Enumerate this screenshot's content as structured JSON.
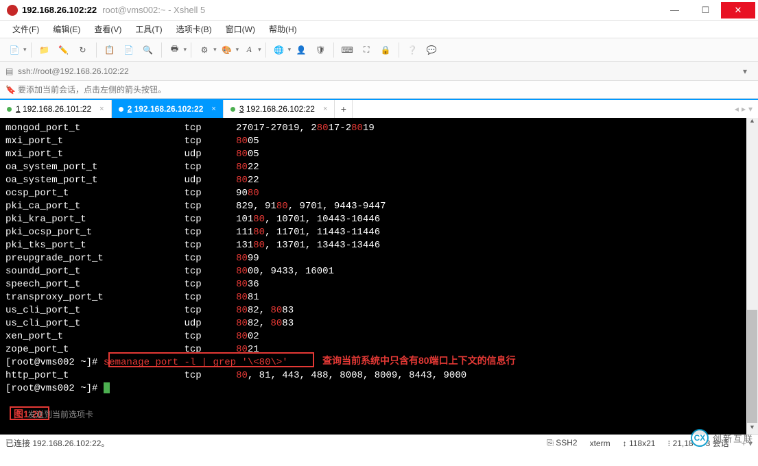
{
  "title": {
    "main": "192.168.26.102:22",
    "sub": "root@vms002:~ - Xshell 5"
  },
  "menu": {
    "file": "文件(F)",
    "edit": "编辑(E)",
    "view": "查看(V)",
    "tools": "工具(T)",
    "tabs": "选项卡(B)",
    "window": "窗口(W)",
    "help": "帮助(H)"
  },
  "address": {
    "url": "ssh://root@192.168.26.102:22"
  },
  "infobar": {
    "text": "要添加当前会话，点击左侧的箭头按钮。"
  },
  "tabs": {
    "items": [
      {
        "num": "1",
        "label": "192.168.26.101:22"
      },
      {
        "num": "2",
        "label": "192.168.26.102:22"
      },
      {
        "num": "3",
        "label": "192.168.26.102:22"
      }
    ]
  },
  "terminal": {
    "lines": [
      {
        "segs": [
          {
            "c": "w",
            "t": "mongod_port_t                  tcp      27017-27019, 2"
          },
          {
            "c": "r",
            "t": "80"
          },
          {
            "c": "w",
            "t": "17-2"
          },
          {
            "c": "r",
            "t": "80"
          },
          {
            "c": "w",
            "t": "19"
          }
        ]
      },
      {
        "segs": [
          {
            "c": "w",
            "t": "mxi_port_t                     tcp      "
          },
          {
            "c": "r",
            "t": "80"
          },
          {
            "c": "w",
            "t": "05"
          }
        ]
      },
      {
        "segs": [
          {
            "c": "w",
            "t": "mxi_port_t                     udp      "
          },
          {
            "c": "r",
            "t": "80"
          },
          {
            "c": "w",
            "t": "05"
          }
        ]
      },
      {
        "segs": [
          {
            "c": "w",
            "t": "oa_system_port_t               tcp      "
          },
          {
            "c": "r",
            "t": "80"
          },
          {
            "c": "w",
            "t": "22"
          }
        ]
      },
      {
        "segs": [
          {
            "c": "w",
            "t": "oa_system_port_t               udp      "
          },
          {
            "c": "r",
            "t": "80"
          },
          {
            "c": "w",
            "t": "22"
          }
        ]
      },
      {
        "segs": [
          {
            "c": "w",
            "t": "ocsp_port_t                    tcp      90"
          },
          {
            "c": "r",
            "t": "80"
          }
        ]
      },
      {
        "segs": [
          {
            "c": "w",
            "t": "pki_ca_port_t                  tcp      829, 91"
          },
          {
            "c": "r",
            "t": "80"
          },
          {
            "c": "w",
            "t": ", 9701, 9443-9447"
          }
        ]
      },
      {
        "segs": [
          {
            "c": "w",
            "t": "pki_kra_port_t                 tcp      101"
          },
          {
            "c": "r",
            "t": "80"
          },
          {
            "c": "w",
            "t": ", 10701, 10443-10446"
          }
        ]
      },
      {
        "segs": [
          {
            "c": "w",
            "t": "pki_ocsp_port_t                tcp      111"
          },
          {
            "c": "r",
            "t": "80"
          },
          {
            "c": "w",
            "t": ", 11701, 11443-11446"
          }
        ]
      },
      {
        "segs": [
          {
            "c": "w",
            "t": "pki_tks_port_t                 tcp      131"
          },
          {
            "c": "r",
            "t": "80"
          },
          {
            "c": "w",
            "t": ", 13701, 13443-13446"
          }
        ]
      },
      {
        "segs": [
          {
            "c": "w",
            "t": "preupgrade_port_t              tcp      "
          },
          {
            "c": "r",
            "t": "80"
          },
          {
            "c": "w",
            "t": "99"
          }
        ]
      },
      {
        "segs": [
          {
            "c": "w",
            "t": "soundd_port_t                  tcp      "
          },
          {
            "c": "r",
            "t": "80"
          },
          {
            "c": "w",
            "t": "00, 9433, 16001"
          }
        ]
      },
      {
        "segs": [
          {
            "c": "w",
            "t": "speech_port_t                  tcp      "
          },
          {
            "c": "r",
            "t": "80"
          },
          {
            "c": "w",
            "t": "36"
          }
        ]
      },
      {
        "segs": [
          {
            "c": "w",
            "t": "transproxy_port_t              tcp      "
          },
          {
            "c": "r",
            "t": "80"
          },
          {
            "c": "w",
            "t": "81"
          }
        ]
      },
      {
        "segs": [
          {
            "c": "w",
            "t": "us_cli_port_t                  tcp      "
          },
          {
            "c": "r",
            "t": "80"
          },
          {
            "c": "w",
            "t": "82, "
          },
          {
            "c": "r",
            "t": "80"
          },
          {
            "c": "w",
            "t": "83"
          }
        ]
      },
      {
        "segs": [
          {
            "c": "w",
            "t": "us_cli_port_t                  udp      "
          },
          {
            "c": "r",
            "t": "80"
          },
          {
            "c": "w",
            "t": "82, "
          },
          {
            "c": "r",
            "t": "80"
          },
          {
            "c": "w",
            "t": "83"
          }
        ]
      },
      {
        "segs": [
          {
            "c": "w",
            "t": "xen_port_t                     tcp      "
          },
          {
            "c": "r",
            "t": "80"
          },
          {
            "c": "w",
            "t": "02"
          }
        ]
      },
      {
        "segs": [
          {
            "c": "w",
            "t": "zope_port_t                    tcp      "
          },
          {
            "c": "r",
            "t": "80"
          },
          {
            "c": "w",
            "t": "21"
          }
        ]
      },
      {
        "segs": [
          {
            "c": "w",
            "t": "[root@vms002 ~]# "
          },
          {
            "c": "r",
            "t": "semanage port -l | grep '\\<80\\>'"
          }
        ]
      },
      {
        "segs": [
          {
            "c": "w",
            "t": "http_port_t                    tcp      "
          },
          {
            "c": "r",
            "t": "80"
          },
          {
            "c": "w",
            "t": ", 81, 443, 488, 8008, 8009, 8443, 9000"
          }
        ]
      },
      {
        "segs": [
          {
            "c": "w",
            "t": "[root@vms002 ~]# "
          }
        ],
        "cursor": true
      }
    ],
    "annotation": "查询当前系统中只含有80端口上下文的信息行",
    "figlabel": "图1-20",
    "footnote": "发送到当前选项卡"
  },
  "status": {
    "connected": "已连接 192.168.26.102:22。",
    "ssh": "SSH2",
    "term": "xterm",
    "size": "118x21",
    "pos": "21,18",
    "sess": "3 会话"
  },
  "watermark": "创新互联"
}
